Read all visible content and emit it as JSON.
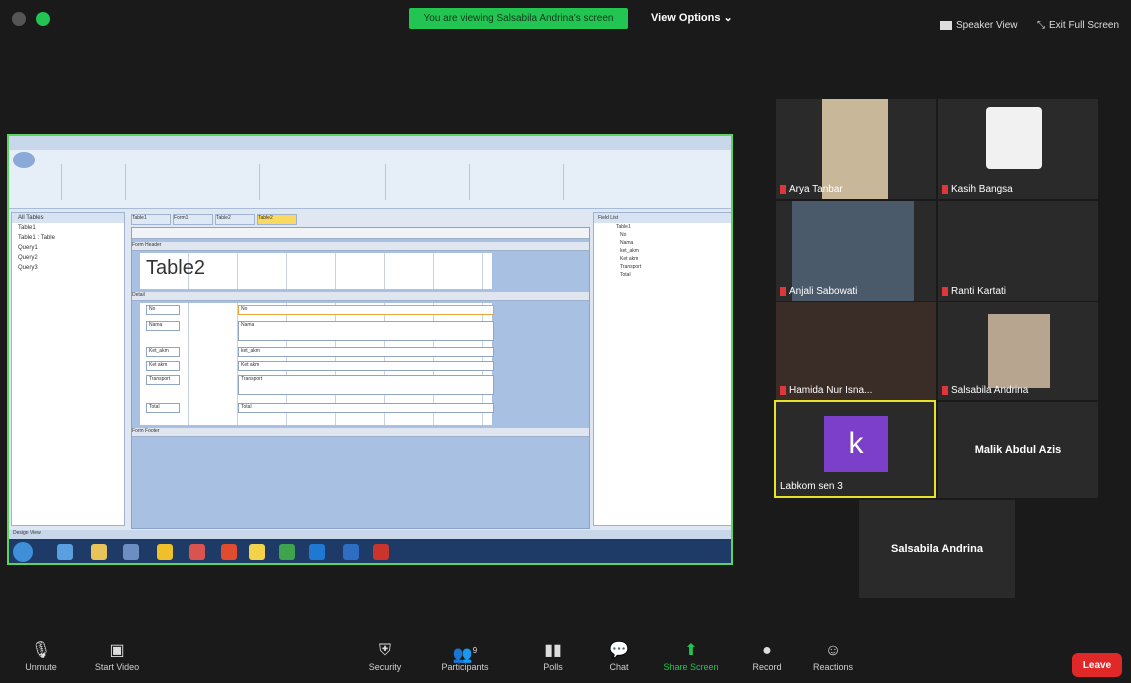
{
  "top": {
    "viewing_banner": "You are viewing Salsabila Andrina's screen",
    "view_options": "View Options ⌄",
    "speaker_view": "Speaker View",
    "exit_full_screen": "Exit Full Screen"
  },
  "shared_screen": {
    "nav_header": "All Tables",
    "nav_items": [
      "Table1",
      "Table1 : Table",
      "Query1",
      "Query2",
      "Query3"
    ],
    "object_tabs": [
      "Table1",
      "Form1",
      "Table2",
      "Table2"
    ],
    "sections": [
      "Form Header",
      "Detail",
      "Form Footer"
    ],
    "form_title": "Table2",
    "fields": [
      {
        "label": "No",
        "value": "No"
      },
      {
        "label": "Nama",
        "value": "Nama"
      },
      {
        "label": "Ket_akm",
        "value": "ket_akm"
      },
      {
        "label": "Ket akm",
        "value": "Ket akm"
      },
      {
        "label": "Transport",
        "value": "Transport"
      },
      {
        "label": "Total",
        "value": "Total"
      }
    ],
    "field_list_title": "Field List",
    "field_list_items": [
      "Table1",
      "No",
      "Nama",
      "ket_akm",
      "Ket akm",
      "Transport",
      "Total"
    ],
    "status_left": "Design View"
  },
  "participants": [
    {
      "name": "Arya Tanbar",
      "muted": true
    },
    {
      "name": "Kasih Bangsa",
      "muted": true
    },
    {
      "name": "Anjali Sabowati",
      "muted": true
    },
    {
      "name": "Ranti Kartati",
      "muted": true
    },
    {
      "name": "Hamida Nur Isna...",
      "muted": true
    },
    {
      "name": "Salsabila Andrina",
      "muted": true
    },
    {
      "name": "Labkom sen 3",
      "muted": true,
      "avatar_letter": "k"
    },
    {
      "name": "Malik Abdul Azis",
      "muted": true
    },
    {
      "name": "Salsabila Andrina",
      "muted": false
    }
  ],
  "toolbar": {
    "unmute": "Unmute",
    "start_video": "Start Video",
    "security": "Security",
    "participants": "Participants",
    "participants_count": "9",
    "polls": "Polls",
    "chat": "Chat",
    "share_screen": "Share Screen",
    "record": "Record",
    "reactions": "Reactions",
    "leave": "Leave"
  },
  "colors": {
    "banner_green": "#23c552",
    "active_speaker_border": "#e7e12a",
    "leave_red": "#e02828",
    "avatar_purple": "#7b3fc9"
  }
}
